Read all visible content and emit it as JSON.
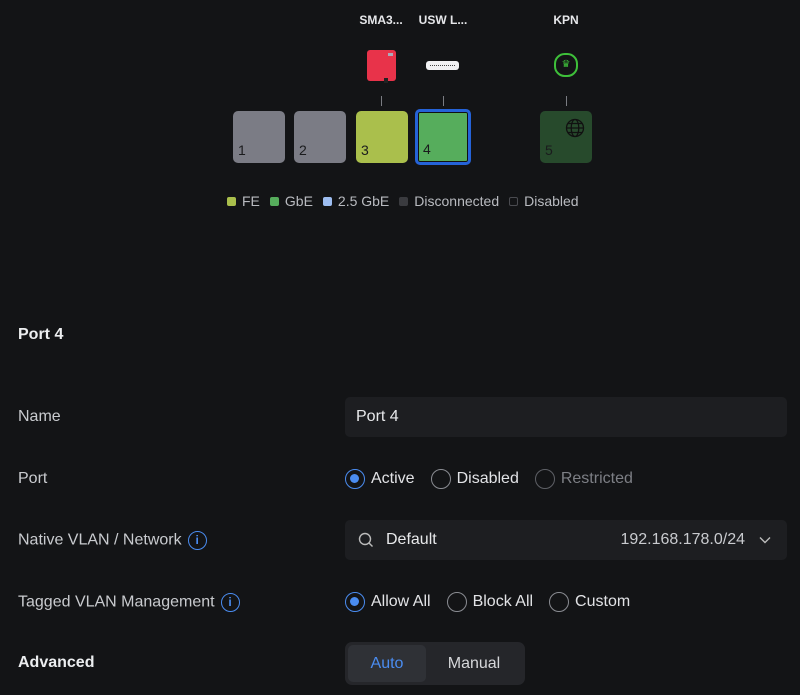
{
  "devices": [
    {
      "label": "SMA3...",
      "port": "3"
    },
    {
      "label": "USW L...",
      "port": "4"
    },
    {
      "label": "KPN",
      "port": "5"
    }
  ],
  "ports": [
    {
      "number": "1",
      "state": "Disconnected",
      "color": "#7b7c85"
    },
    {
      "number": "2",
      "state": "Disconnected",
      "color": "#7b7c85"
    },
    {
      "number": "3",
      "state": "FE",
      "color": "#aabf4c"
    },
    {
      "number": "4",
      "state": "GbE",
      "color": "#56ad5c",
      "selected": true
    },
    {
      "number": "5",
      "state": "WAN",
      "color": "#274a2c",
      "icon": "globe-icon"
    }
  ],
  "legend": [
    {
      "label": "FE",
      "color": "#aabf4c"
    },
    {
      "label": "GbE",
      "color": "#56ad5c"
    },
    {
      "label": "2.5 GbE",
      "color": "#9dbdf0"
    },
    {
      "label": "Disconnected",
      "color": "#3a3b3f"
    },
    {
      "label": "Disabled",
      "color": "#131416"
    }
  ],
  "section_title": "Port 4",
  "form": {
    "name_label": "Name",
    "name_value": "Port 4",
    "port_label": "Port",
    "port_options": [
      "Active",
      "Disabled",
      "Restricted"
    ],
    "port_selected": "Active",
    "vlan_label": "Native VLAN / Network",
    "vlan_value": "Default",
    "vlan_subnet": "192.168.178.0/24",
    "tagged_label": "Tagged VLAN Management",
    "tagged_options": [
      "Allow All",
      "Block All",
      "Custom"
    ],
    "tagged_selected": "Allow All",
    "advanced_label": "Advanced",
    "advanced_options": [
      "Auto",
      "Manual"
    ],
    "advanced_selected": "Auto",
    "info_glyph": "i"
  },
  "colors": {
    "accent": "#4a8cf0",
    "background": "#131416"
  }
}
